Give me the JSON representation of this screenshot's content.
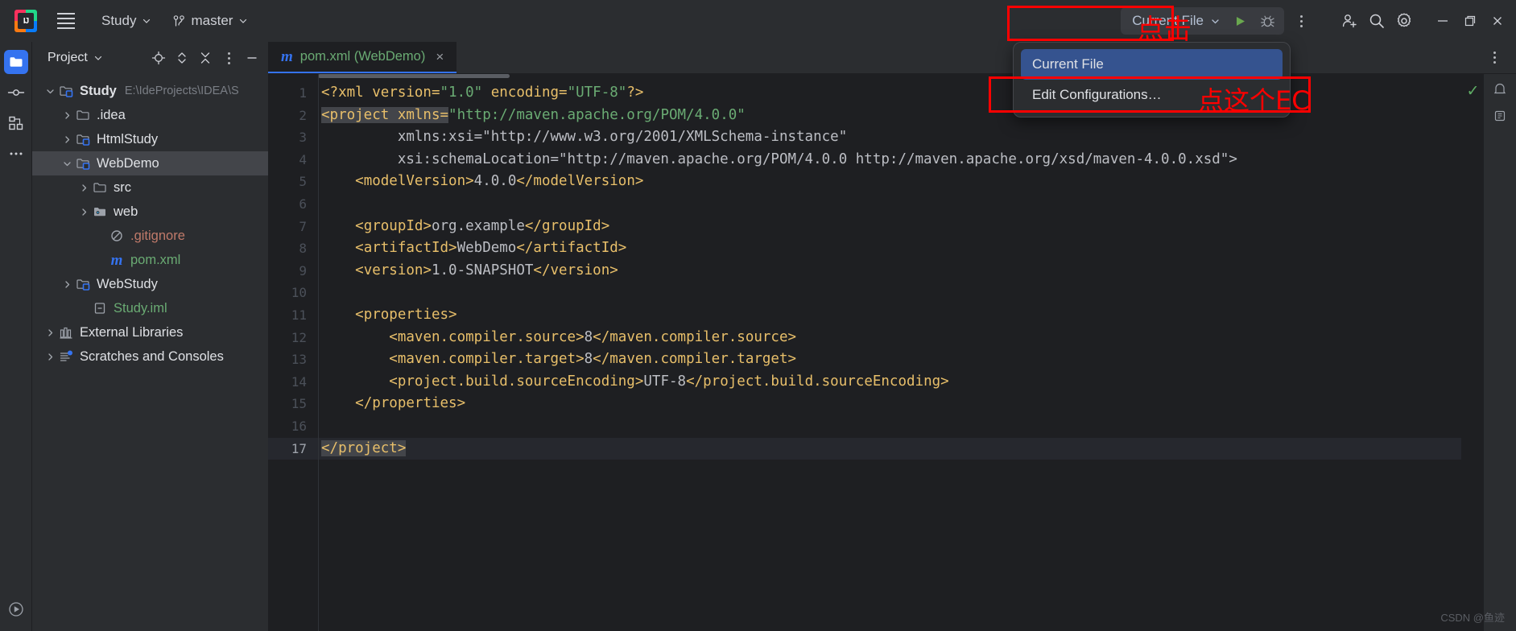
{
  "titlebar": {
    "logo_text": "IJ",
    "project_name": "Study",
    "branch_name": "master",
    "run_config": "Current File",
    "menu_icon": "hamburger-icon",
    "icons": {
      "run": "run-icon",
      "debug": "debug-icon",
      "more": "more-vertical-icon",
      "add_user": "add-user-icon",
      "search": "search-icon",
      "settings": "gear-icon",
      "minimize": "minimize-icon",
      "maximize": "maximize-icon",
      "close": "close-icon"
    }
  },
  "run_dropdown": {
    "items": [
      {
        "label": "Current File",
        "selected": true
      },
      {
        "label": "Edit Configurations…",
        "selected": false
      }
    ]
  },
  "annotations": [
    {
      "text": "点击",
      "name": "annotation-click"
    },
    {
      "text": "点这个EC",
      "name": "annotation-click-this-ec"
    }
  ],
  "sidebar": {
    "stripe": [
      {
        "name": "project-tool-button",
        "icon": "folder-icon",
        "active": true
      },
      {
        "name": "commit-tool-button",
        "icon": "commit-icon",
        "active": false
      },
      {
        "name": "structure-tool-button",
        "icon": "structure-icon",
        "active": false
      },
      {
        "name": "more-tool-button",
        "icon": "ellipsis-icon",
        "active": false
      }
    ],
    "stripe_bottom": [
      {
        "name": "run-tool-button",
        "icon": "play-circle-icon"
      }
    ]
  },
  "project_panel": {
    "title": "Project",
    "actions": [
      {
        "name": "select-opened-file-button",
        "icon": "target-icon"
      },
      {
        "name": "expand-collapse-button",
        "icon": "updown-icon"
      },
      {
        "name": "collapse-all-button",
        "icon": "collapse-icon"
      },
      {
        "name": "options-button",
        "icon": "more-vertical-icon"
      },
      {
        "name": "hide-button",
        "icon": "minus-icon"
      }
    ],
    "tree": [
      {
        "label": "Study",
        "path": "E:\\IdeProjects\\IDEA\\S",
        "indent": 0,
        "arrow": "down",
        "icon": "module-folder-icon",
        "style": "bold",
        "selected": false
      },
      {
        "label": ".idea",
        "path": "",
        "indent": 1,
        "arrow": "right",
        "icon": "folder-icon",
        "style": "",
        "selected": false
      },
      {
        "label": "HtmlStudy",
        "path": "",
        "indent": 1,
        "arrow": "right",
        "icon": "module-folder-icon",
        "style": "",
        "selected": false
      },
      {
        "label": "WebDemo",
        "path": "",
        "indent": 1,
        "arrow": "down",
        "icon": "module-folder-icon",
        "style": "",
        "selected": true
      },
      {
        "label": "src",
        "path": "",
        "indent": 2,
        "arrow": "right",
        "icon": "folder-icon",
        "style": "",
        "selected": false
      },
      {
        "label": "web",
        "path": "",
        "indent": 2,
        "arrow": "right",
        "icon": "web-folder-icon",
        "style": "",
        "selected": false
      },
      {
        "label": ".gitignore",
        "path": "",
        "indent": 3,
        "arrow": "none",
        "icon": "gitignore-icon",
        "style": "red",
        "selected": false
      },
      {
        "label": "pom.xml",
        "path": "",
        "indent": 3,
        "arrow": "none",
        "icon": "maven-icon",
        "style": "green",
        "selected": false
      },
      {
        "label": "WebStudy",
        "path": "",
        "indent": 1,
        "arrow": "right",
        "icon": "module-folder-icon",
        "style": "",
        "selected": false
      },
      {
        "label": "Study.iml",
        "path": "",
        "indent": 2,
        "arrow": "none",
        "icon": "iml-icon",
        "style": "green",
        "selected": false
      },
      {
        "label": "External Libraries",
        "path": "",
        "indent": 0,
        "arrow": "right",
        "icon": "library-icon",
        "style": "",
        "selected": false
      },
      {
        "label": "Scratches and Consoles",
        "path": "",
        "indent": 0,
        "arrow": "right",
        "icon": "scratches-icon",
        "style": "",
        "selected": false
      }
    ]
  },
  "editor": {
    "tab": {
      "label": "pom.xml (WebDemo)",
      "icon": "maven-icon",
      "close": "×"
    },
    "inspection_status": "✓",
    "lines": [
      {
        "n": 1,
        "current": false
      },
      {
        "n": 2,
        "current": false
      },
      {
        "n": 3,
        "current": false
      },
      {
        "n": 4,
        "current": false
      },
      {
        "n": 5,
        "current": false
      },
      {
        "n": 6,
        "current": false
      },
      {
        "n": 7,
        "current": false
      },
      {
        "n": 8,
        "current": false
      },
      {
        "n": 9,
        "current": false
      },
      {
        "n": 10,
        "current": false
      },
      {
        "n": 11,
        "current": false
      },
      {
        "n": 12,
        "current": false
      },
      {
        "n": 13,
        "current": false
      },
      {
        "n": 14,
        "current": false
      },
      {
        "n": 15,
        "current": false
      },
      {
        "n": 16,
        "current": false
      },
      {
        "n": 17,
        "current": true
      }
    ],
    "code_text": [
      "<?xml version=\"1.0\" encoding=\"UTF-8\"?>",
      "<project xmlns=\"http://maven.apache.org/POM/4.0.0\"",
      "         xmlns:xsi=\"http://www.w3.org/2001/XMLSchema-instance\"",
      "         xsi:schemaLocation=\"http://maven.apache.org/POM/4.0.0 http://maven.apache.org/xsd/maven-4.0.0.xsd\">",
      "    <modelVersion>4.0.0</modelVersion>",
      "",
      "    <groupId>org.example</groupId>",
      "    <artifactId>WebDemo</artifactId>",
      "    <version>1.0-SNAPSHOT</version>",
      "",
      "    <properties>",
      "        <maven.compiler.source>8</maven.compiler.source>",
      "        <maven.compiler.target>8</maven.compiler.target>",
      "        <project.build.sourceEncoding>UTF-8</project.build.sourceEncoding>",
      "    </properties>",
      "",
      "</project>"
    ]
  },
  "watermark": {
    "text": "CSDN @鱼迹"
  }
}
